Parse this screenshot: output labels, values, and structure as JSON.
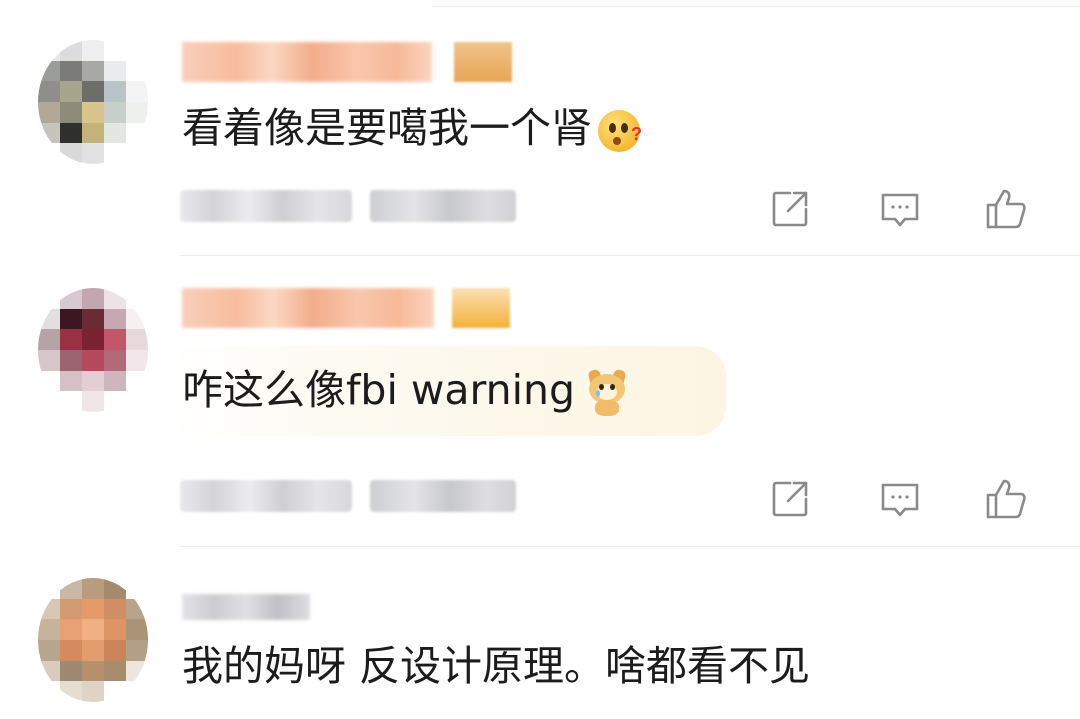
{
  "comments": [
    {
      "username": "",
      "text": "看着像是要噶我一个肾",
      "emoji": "thinking-face-emoji",
      "meta": "",
      "actions": {
        "share": "share-icon",
        "reply": "comment-icon",
        "like": "thumbs-up-icon"
      }
    },
    {
      "username": "",
      "text": "咋这么像fbi warning",
      "emoji": "crying-dog-emoji",
      "meta": "",
      "actions": {
        "share": "share-icon",
        "reply": "comment-icon",
        "like": "thumbs-up-icon"
      }
    },
    {
      "username": "",
      "text": "我的妈呀 反设计原理。啥都看不见"
    }
  ],
  "colors": {
    "text": "#1c1c1c",
    "icon": "#8a8a8a",
    "divider": "#ececec",
    "username_blur": "#f6b693",
    "bubble": "#fdf5e2"
  }
}
